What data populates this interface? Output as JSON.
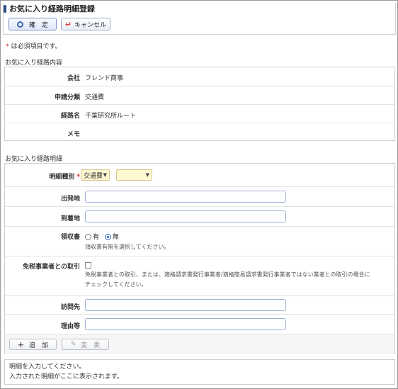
{
  "header": {
    "title": "お気に入り経路明細登録",
    "confirm_label": "確　定",
    "cancel_label": "キャンセル"
  },
  "required_note": {
    "mark": "*",
    "text": "は必須項目です。"
  },
  "route_info": {
    "section_title": "お気に入り経路内容",
    "rows": [
      {
        "label": "会社",
        "value": "フレンド商事"
      },
      {
        "label": "申請分類",
        "value": "交通費"
      },
      {
        "label": "経路名",
        "value": "千葉研究所ルート"
      },
      {
        "label": "メモ",
        "value": ""
      }
    ]
  },
  "detail_form": {
    "section_title": "お気に入り経路明細",
    "type_label": "明細種別",
    "required_mark": "*",
    "type_value": "交通費",
    "subtype_value": "",
    "departure_label": "出発地",
    "departure_value": "",
    "arrival_label": "到着地",
    "arrival_value": "",
    "receipt_label": "領収書",
    "receipt_options": [
      "有",
      "無"
    ],
    "receipt_selected": "無",
    "receipt_hint": "領収書有無を選択してください。",
    "tax_exempt_label": "免税事業者との取引",
    "tax_exempt_checked": false,
    "tax_exempt_hint_1": "免税事業者との取引、または、適格請求書発行事業者/適格簡易請求書発行事業者ではない業者との取引の場合に",
    "tax_exempt_hint_2": "チェックしてください。",
    "visit_label": "訪問先",
    "visit_value": "",
    "reason_label": "理由等",
    "reason_value": "",
    "add_label": "追　加",
    "change_label": "変　更"
  },
  "footer": {
    "line1": "明細を入力してください。",
    "line2": "入力された明細がここに表示されます。"
  },
  "colors": {
    "title_mark": "#2b4f8a",
    "required": "#d21f1f",
    "select_bg": "#fff7d2"
  }
}
